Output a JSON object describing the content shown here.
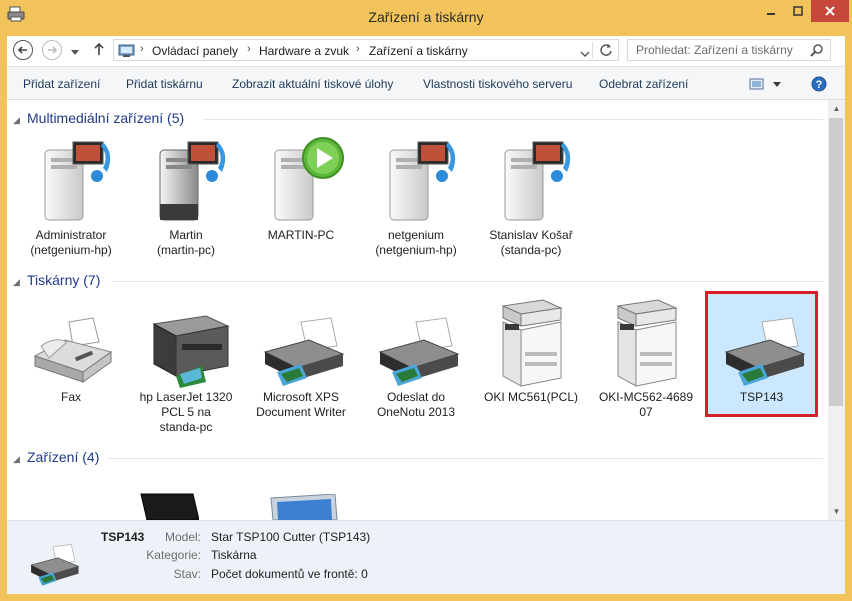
{
  "window": {
    "title": "Zařízení a tiskárny"
  },
  "address": {
    "crumbs": [
      "Ovládací panely",
      "Hardware a zvuk",
      "Zařízení a tiskárny"
    ],
    "search_placeholder": "Prohledat: Zařízení a tiskárny"
  },
  "toolbar": {
    "items": [
      "Přidat zařízení",
      "Přidat tiskárnu",
      "Zobrazit aktuální tiskové úlohy",
      "Vlastnosti tiskového serveru",
      "Odebrat zařízení"
    ]
  },
  "groups": {
    "multimedia": {
      "title": "Multimediální zařízení (5)",
      "items": [
        {
          "label1": "Administrator",
          "label2": "(netgenium-hp)"
        },
        {
          "label1": "Martin",
          "label2": "(martin-pc)"
        },
        {
          "label1": "MARTIN-PC",
          "label2": ""
        },
        {
          "label1": "netgenium",
          "label2": "(netgenium-hp)"
        },
        {
          "label1": "Stanislav Košař",
          "label2": "(standa-pc)"
        }
      ]
    },
    "printers": {
      "title": "Tiskárny (7)",
      "items": [
        {
          "label1": "Fax",
          "label2": "",
          "label3": ""
        },
        {
          "label1": "hp LaserJet 1320",
          "label2": "PCL 5 na",
          "label3": "standa-pc"
        },
        {
          "label1": "Microsoft XPS",
          "label2": "Document Writer",
          "label3": ""
        },
        {
          "label1": "Odeslat do",
          "label2": "OneNotu 2013",
          "label3": ""
        },
        {
          "label1": "OKI MC561(PCL)",
          "label2": "",
          "label3": ""
        },
        {
          "label1": "OKI-MC562-4689",
          "label2": "07",
          "label3": ""
        },
        {
          "label1": "TSP143",
          "label2": "",
          "label3": ""
        }
      ]
    },
    "devices": {
      "title": "Zařízení (4)"
    }
  },
  "details": {
    "name": "TSP143",
    "model_key": "Model:",
    "model_value": "Star TSP100 Cutter (TSP143)",
    "category_key": "Kategorie:",
    "category_value": "Tiskárna",
    "status_key": "Stav:",
    "status_value": "Počet dokumentů ve frontě: 0"
  },
  "colors": {
    "accent": "#1e3a8a",
    "selection": "#cce8ff",
    "highlight_border": "#d61f26",
    "frame": "#f1c35a"
  }
}
